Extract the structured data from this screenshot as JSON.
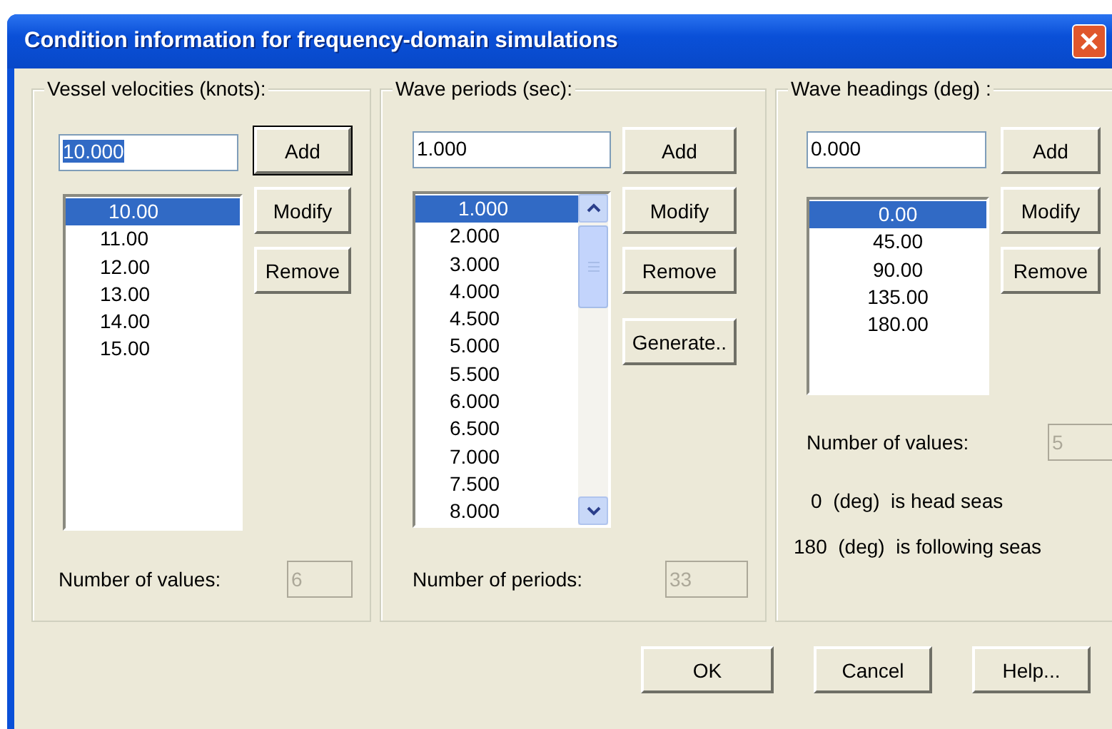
{
  "window": {
    "title": "Condition information for frequency-domain simulations"
  },
  "groups": [
    {
      "title": "Vessel velocities (knots):",
      "input": "10.000",
      "input_selected": true,
      "scrollable": false,
      "items": [
        {
          "label": "10.00",
          "selected": true
        },
        {
          "label": "11.00",
          "selected": false
        },
        {
          "label": "12.00",
          "selected": false
        },
        {
          "label": "13.00",
          "selected": false
        },
        {
          "label": "14.00",
          "selected": false
        },
        {
          "label": "15.00",
          "selected": false
        }
      ],
      "buttons": [
        {
          "label": "Add",
          "default": true
        },
        {
          "label": "Modify",
          "default": false
        },
        {
          "label": "Remove",
          "default": false
        }
      ],
      "count_label": "Number of values:",
      "count": "6"
    },
    {
      "title": "Wave periods (sec):",
      "input": "1.000",
      "input_selected": false,
      "scrollable": true,
      "items": [
        {
          "label": "1.000",
          "selected": true
        },
        {
          "label": "2.000",
          "selected": false
        },
        {
          "label": "3.000",
          "selected": false
        },
        {
          "label": "4.000",
          "selected": false
        },
        {
          "label": "4.500",
          "selected": false
        },
        {
          "label": "5.000",
          "selected": false
        },
        {
          "label": "5.500",
          "selected": false
        },
        {
          "label": "6.000",
          "selected": false
        },
        {
          "label": "6.500",
          "selected": false
        },
        {
          "label": "7.000",
          "selected": false
        },
        {
          "label": "7.500",
          "selected": false
        },
        {
          "label": "8.000",
          "selected": false
        }
      ],
      "buttons": [
        {
          "label": "Add",
          "default": false
        },
        {
          "label": "Modify",
          "default": false
        },
        {
          "label": "Remove",
          "default": false
        },
        {
          "label": "Generate..",
          "default": false
        }
      ],
      "count_label": "Number of periods:",
      "count": "33"
    },
    {
      "title": "Wave headings (deg) :",
      "input": "0.000",
      "input_selected": false,
      "scrollable": false,
      "items": [
        {
          "label": "0.00",
          "selected": true
        },
        {
          "label": "45.00",
          "selected": false
        },
        {
          "label": "90.00",
          "selected": false
        },
        {
          "label": "135.00",
          "selected": false
        },
        {
          "label": "180.00",
          "selected": false
        }
      ],
      "buttons": [
        {
          "label": "Add",
          "default": false
        },
        {
          "label": "Modify",
          "default": false
        },
        {
          "label": "Remove",
          "default": false
        }
      ],
      "count_label": "Number of values:",
      "count": "5",
      "notes": [
        "0  (deg)  is head seas",
        "180  (deg)  is following seas"
      ]
    }
  ],
  "buttons": [
    "OK",
    "Cancel",
    "Help..."
  ]
}
